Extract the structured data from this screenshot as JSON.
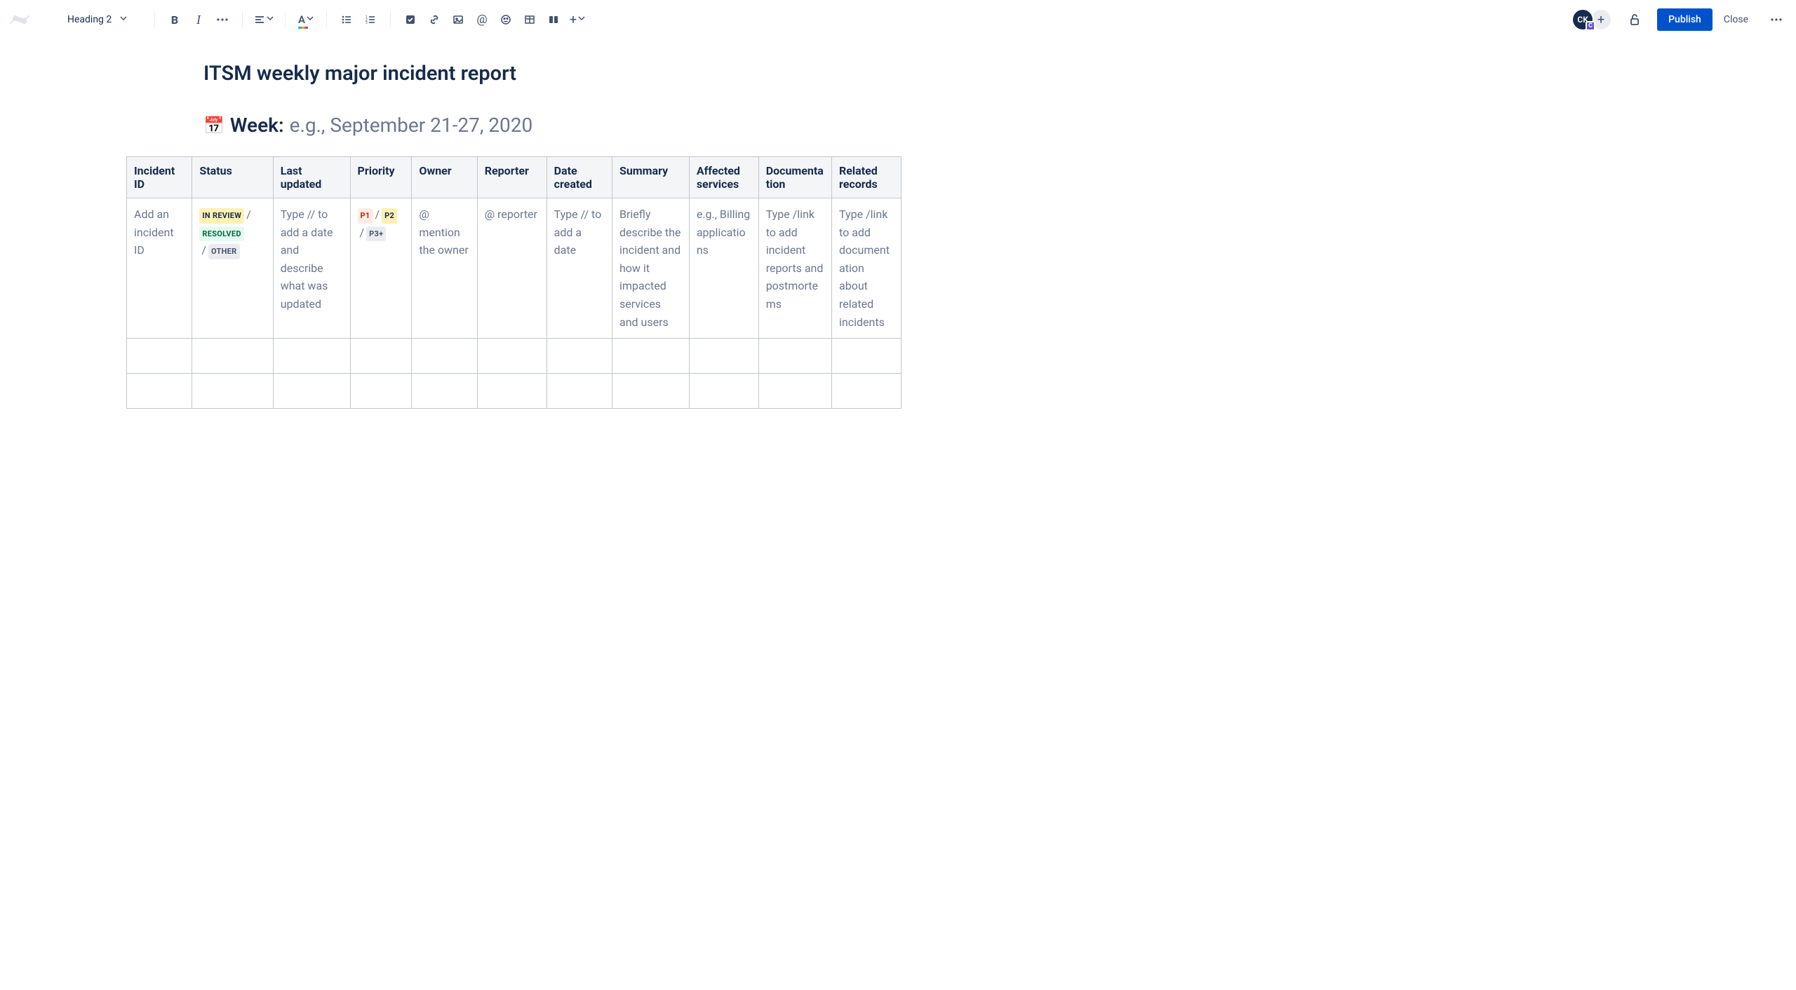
{
  "toolbar": {
    "text_style": "Heading 2",
    "avatar_initials": "CK",
    "avatar_badge": "C",
    "publish_label": "Publish",
    "close_label": "Close"
  },
  "page": {
    "title": "ITSM weekly major incident report",
    "week_label": "Week:",
    "week_placeholder": "e.g., September 21-27, 2020",
    "calendar_emoji": "📅"
  },
  "table": {
    "headers": [
      "Incident ID",
      "Status",
      "Last updated",
      "Priority",
      "Owner",
      "Reporter",
      "Date created",
      "Summary",
      "Affected services",
      "Documentation",
      "Related records"
    ],
    "row1": {
      "incident_id": "Add an incident ID",
      "status": {
        "a": "IN REVIEW",
        "b": "RESOLVED",
        "c": "OTHER"
      },
      "last_updated": "Type // to add a date and describe what was updated",
      "priority": {
        "p1": "P1",
        "p2": "P2",
        "p3": "P3+"
      },
      "owner": "@ mention the owner",
      "reporter": "@ reporter",
      "date_created": "Type // to add a date",
      "summary": "Briefly describe the incident and how it impacted services and users",
      "affected": "e.g., Billing applications",
      "documentation": "Type /link to add incident reports and postmortems",
      "related": "Type /link to add documentation about related incidents"
    }
  },
  "col_widths": [
    "85",
    "105",
    "100",
    "80",
    "85",
    "90",
    "85",
    "100",
    "90",
    "95",
    "90"
  ]
}
